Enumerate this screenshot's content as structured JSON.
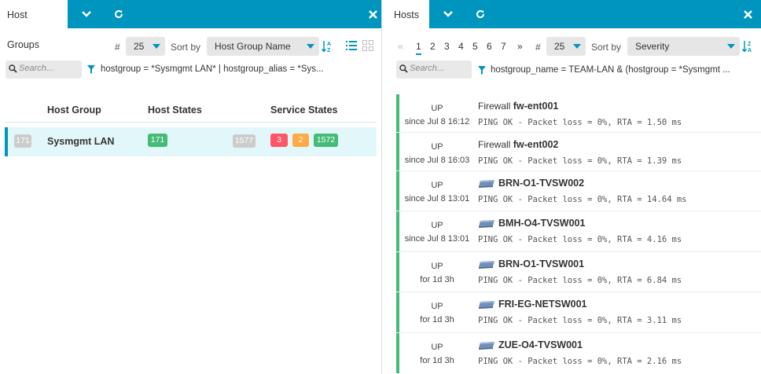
{
  "left": {
    "tab_label": "Host Groups",
    "controls": {
      "hash": "#",
      "limit": "25",
      "sort_by_label": "Sort by",
      "sort_value": "Host Group Name",
      "search_placeholder": "Search...",
      "filter": "hostgroup = *Sysmgmt LAN* | hostgroup_alias = *Sys..."
    },
    "columns": [
      "Host Group",
      "Host States",
      "Service States"
    ],
    "rows": [
      {
        "total_hosts": "171",
        "name": "Sysmgmt LAN",
        "hosts_up": "171",
        "services_total": "1577",
        "services_critical": "3",
        "services_warning": "2",
        "services_ok": "1572"
      }
    ]
  },
  "right": {
    "tab_label": "Hosts",
    "pagination": {
      "prev": "«",
      "pages": [
        "1",
        "2",
        "3",
        "4",
        "5",
        "6",
        "7"
      ],
      "next": "»",
      "current": "1"
    },
    "controls": {
      "hash": "#",
      "limit": "25",
      "sort_by_label": "Sort by",
      "sort_value": "Severity",
      "search_placeholder": "Search...",
      "filter": "hostgroup_name = TEAM-LAN & (hostgroup = *Sysmgmt ..."
    },
    "hosts": [
      {
        "state": "UP",
        "since": "since Jul 8 16:12",
        "prefix": "Firewall",
        "name": "fw-ent001",
        "icon": "",
        "output": "PING OK - Packet loss = 0%, RTA = 1.50 ms"
      },
      {
        "state": "UP",
        "since": "since Jul 8 16:03",
        "prefix": "Firewall",
        "name": "fw-ent002",
        "icon": "",
        "output": "PING OK - Packet loss = 0%, RTA = 1.39 ms"
      },
      {
        "state": "UP",
        "since": "since Jul 8 13:01",
        "prefix": "",
        "name": "BRN-O1-TVSW002",
        "icon": "switch-icon",
        "output": "PING OK - Packet loss = 0%, RTA = 14.64 ms"
      },
      {
        "state": "UP",
        "since": "since Jul 8 13:01",
        "prefix": "",
        "name": "BMH-O4-TVSW001",
        "icon": "switch-icon",
        "output": "PING OK - Packet loss = 0%, RTA = 4.16 ms"
      },
      {
        "state": "UP",
        "since": "for 1d 3h",
        "prefix": "",
        "name": "BRN-O1-TVSW001",
        "icon": "switch-icon",
        "output": "PING OK - Packet loss = 0%, RTA = 6.84 ms"
      },
      {
        "state": "UP",
        "since": "for 1d 3h",
        "prefix": "",
        "name": "FRI-EG-NETSW001",
        "icon": "switch-icon",
        "output": "PING OK - Packet loss = 0%, RTA = 3.11 ms"
      },
      {
        "state": "UP",
        "since": "for 1d 3h",
        "prefix": "",
        "name": "ZUE-O4-TVSW001",
        "icon": "switch-icon",
        "output": "PING OK - Packet loss = 0%, RTA = 2.16 ms"
      }
    ]
  },
  "colors": {
    "accent": "#0095bf",
    "up": "#44bb77",
    "critical": "#ff5566",
    "warning": "#ffaa44",
    "pending": "#cccccc",
    "selected_row": "#e2f7fa"
  }
}
